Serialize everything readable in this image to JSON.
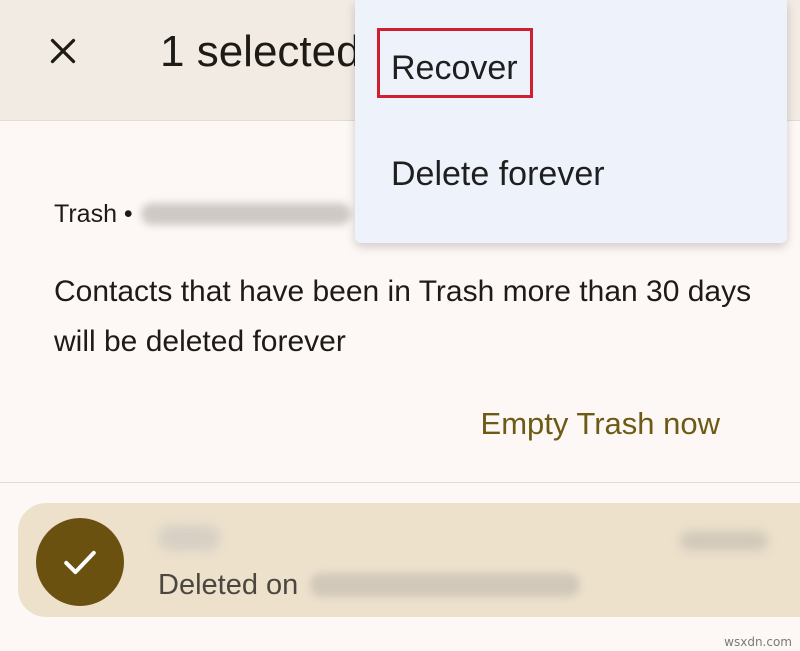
{
  "header": {
    "title": "1 selected",
    "close_icon": "close-icon"
  },
  "trash_info": {
    "label": "Trash •",
    "notice": "Contacts that have been in Trash more than 30 days will be deleted forever",
    "empty_trash_label": "Empty Trash now"
  },
  "contact": {
    "deleted_label": "Deleted on",
    "avatar_icon": "check-icon"
  },
  "menu": {
    "items": [
      {
        "label": "Recover",
        "highlighted": true
      },
      {
        "label": "Delete forever",
        "highlighted": false
      }
    ]
  },
  "colors": {
    "accent": "#6d5a15",
    "avatar": "#6b5110",
    "selected_row": "#ede1cc",
    "highlight": "#d0202f"
  },
  "watermark": "wsxdn.com"
}
